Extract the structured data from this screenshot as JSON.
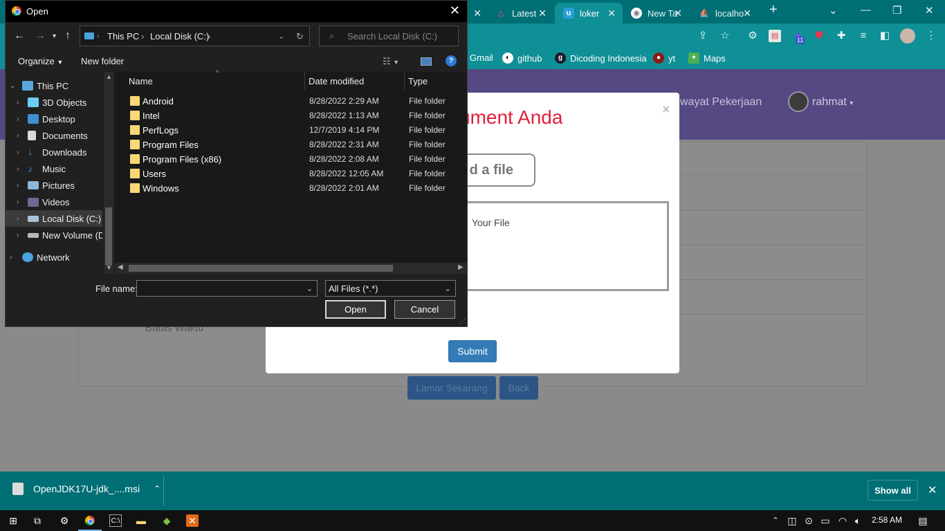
{
  "browser": {
    "tabs": [
      {
        "label": "Latest",
        "icon": "a"
      },
      {
        "label": "loker",
        "icon": "u"
      },
      {
        "label": "New Ta",
        "icon": "chrome"
      },
      {
        "label": "localho",
        "icon": "pma"
      }
    ],
    "bookmarks": [
      {
        "label": "Gmail"
      },
      {
        "label": "github"
      },
      {
        "label": "Dicoding Indonesia"
      },
      {
        "label": "yt"
      },
      {
        "label": "Maps"
      }
    ],
    "profile_badge": "11"
  },
  "site": {
    "nav_link": "wayat Pekerjaan",
    "user_name": "rahmat",
    "batas_waktu": "Batas Waktu",
    "apply_button": "Lamar Sekarang",
    "back_button": "Back"
  },
  "modal": {
    "title": "ument Anda",
    "close": "×",
    "upload_button": "d a file",
    "upload_area_text": "Your File",
    "submit": "Submit"
  },
  "dialog": {
    "title": "Open",
    "breadcrumb": [
      "This PC",
      "Local Disk (C:)"
    ],
    "search_placeholder": "Search Local Disk (C:)",
    "organize": "Organize",
    "new_folder": "New folder",
    "nav_tree": [
      {
        "label": "This PC",
        "icon": "computer-icon",
        "level": 0,
        "expanded": true
      },
      {
        "label": "3D Objects",
        "icon": "cube-icon",
        "level": 1
      },
      {
        "label": "Desktop",
        "icon": "desktop-icon",
        "level": 1
      },
      {
        "label": "Documents",
        "icon": "document-icon",
        "level": 1
      },
      {
        "label": "Downloads",
        "icon": "download-icon",
        "level": 1
      },
      {
        "label": "Music",
        "icon": "music-icon",
        "level": 1
      },
      {
        "label": "Pictures",
        "icon": "picture-icon",
        "level": 1
      },
      {
        "label": "Videos",
        "icon": "video-icon",
        "level": 1
      },
      {
        "label": "Local Disk (C:)",
        "icon": "drive-icon",
        "level": 1,
        "selected": true
      },
      {
        "label": "New Volume (D:",
        "icon": "drive-icon",
        "level": 1
      },
      {
        "label": "Network",
        "icon": "network-icon",
        "level": 0
      }
    ],
    "columns": [
      "Name",
      "Date modified",
      "Type"
    ],
    "files": [
      {
        "name": "Android",
        "date": "8/28/2022 2:29 AM",
        "type": "File folder"
      },
      {
        "name": "Intel",
        "date": "8/28/2022 1:13 AM",
        "type": "File folder"
      },
      {
        "name": "PerfLogs",
        "date": "12/7/2019 4:14 PM",
        "type": "File folder"
      },
      {
        "name": "Program Files",
        "date": "8/28/2022 2:31 AM",
        "type": "File folder"
      },
      {
        "name": "Program Files (x86)",
        "date": "8/28/2022 2:08 AM",
        "type": "File folder"
      },
      {
        "name": "Users",
        "date": "8/28/2022 12:05 AM",
        "type": "File folder"
      },
      {
        "name": "Windows",
        "date": "8/28/2022 2:01 AM",
        "type": "File folder"
      }
    ],
    "file_name_label": "File name:",
    "file_name_value": "",
    "file_type": "All Files (*.*)",
    "open_button": "Open",
    "cancel_button": "Cancel"
  },
  "downloads": {
    "file": "OpenJDK17U-jdk_....msi",
    "show_all": "Show all"
  },
  "taskbar": {
    "time": "2:58 AM"
  },
  "colors": {
    "chrome_tab_bar": "#006f75",
    "site_nav": "#564883",
    "modal_title": "#e0203a",
    "submit": "#337ab7"
  }
}
